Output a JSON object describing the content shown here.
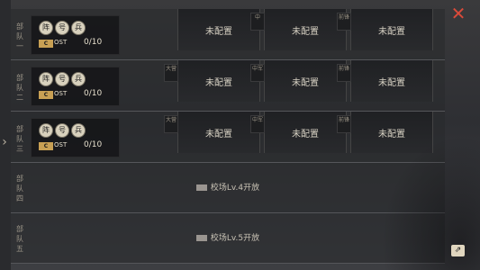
{
  "close_label": "✕",
  "share_label": "⇗",
  "troops": [
    {
      "title_chars": [
        "部",
        "队",
        "一"
      ],
      "badges": [
        "阵",
        "号",
        "兵"
      ],
      "cost_icon_text": "C",
      "cost_label": "OST",
      "cost_value": "0/10",
      "slots": [
        {
          "tag": "",
          "label": "未配置"
        },
        {
          "tag": "中",
          "label": "未配置"
        },
        {
          "tag": "前锋",
          "label": "未配置"
        }
      ]
    },
    {
      "title_chars": [
        "部",
        "队",
        "二"
      ],
      "badges": [
        "阵",
        "号",
        "兵"
      ],
      "cost_icon_text": "C",
      "cost_label": "OST",
      "cost_value": "0/10",
      "slots": [
        {
          "tag": "大营",
          "label": "未配置"
        },
        {
          "tag": "中军",
          "label": "未配置"
        },
        {
          "tag": "前锋",
          "label": "未配置"
        }
      ]
    },
    {
      "title_chars": [
        "部",
        "队",
        "三"
      ],
      "badges": [
        "阵",
        "号",
        "兵"
      ],
      "cost_icon_text": "C",
      "cost_label": "OST",
      "cost_value": "0/10",
      "slots": [
        {
          "tag": "大营",
          "label": "未配置"
        },
        {
          "tag": "中军",
          "label": "未配置"
        },
        {
          "tag": "前锋",
          "label": "未配置"
        }
      ]
    }
  ],
  "locked_troops": [
    {
      "title_chars": [
        "部",
        "队",
        "四"
      ],
      "text": "校场Lv.4开放"
    },
    {
      "title_chars": [
        "部",
        "队",
        "五"
      ],
      "text": "校场Lv.5开放"
    }
  ]
}
